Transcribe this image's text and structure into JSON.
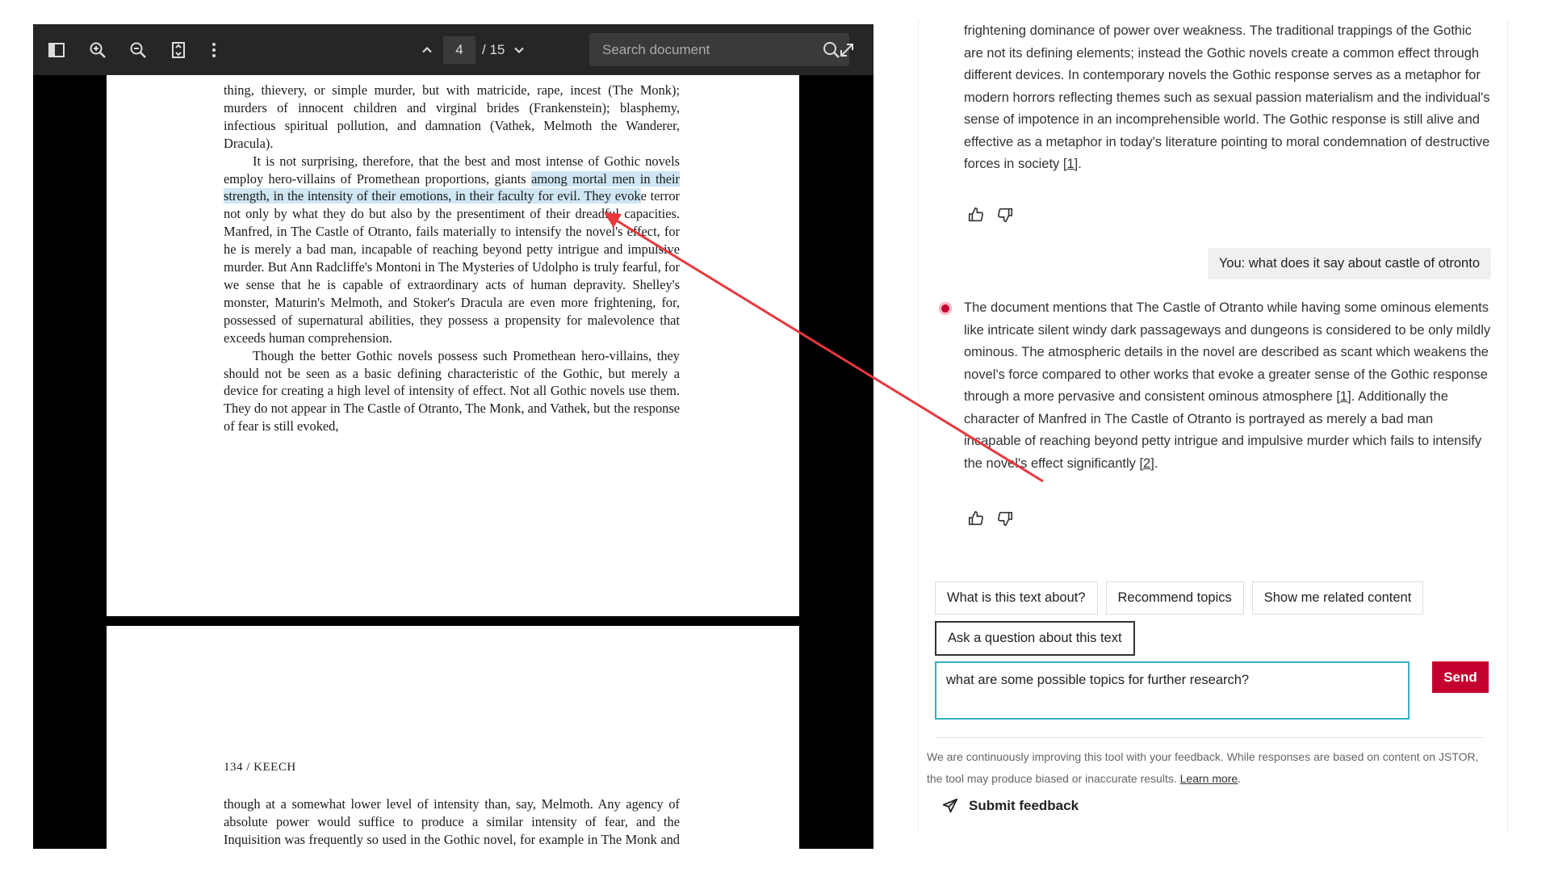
{
  "viewer": {
    "page_current": "4",
    "page_total": "/ 15",
    "search_placeholder": "Search document",
    "icons": [
      "sidebar-toggle-icon",
      "zoom-in-icon",
      "zoom-out-icon",
      "fit-page-icon",
      "more-options-icon",
      "page-up-icon",
      "page-down-icon",
      "search-icon",
      "fullscreen-icon"
    ]
  },
  "page1": {
    "para1": "thing, thievery, or simple murder, but with matricide, rape, incest (The Monk); murders of innocent children and virginal brides (Frankenstein); blasphemy, infectious spiritual pollution, and damnation (Vathek, Melmoth the Wanderer, Dracula).",
    "para2_a": "It is not surprising, therefore, that the best and most intense of Gothic novels employ hero-villains of Promethean proportions, giants ",
    "para2_hl": "among mortal men in their strength, in the intensity of their emotions, in their faculty for evil. They evok",
    "para2_b": "e terror not only by what they do but also by the presentiment of their dreadful capacities. Manfred, in The Castle of Otranto, fails materially to intensify the novel's effect, for he is merely a bad man, incapable of reaching beyond petty intrigue and impulsive murder. But Ann Radcliffe's Montoni in The Mysteries of Udolpho is truly fearful, for we sense that he is capable of extraordinary acts of human depravity. Shelley's monster, Maturin's Melmoth, and Stoker's Dracula are even more frightening, for, possessed of supernatural abilities, they possess a propensity for malevolence that exceeds human comprehension.",
    "para3": "Though the better Gothic novels possess such Promethean hero-villains, they should not be seen as a basic defining characteristic of the Gothic, but merely a device for creating a high level of intensity of effect. Not all Gothic novels use them. They do not appear in The Castle of Otranto, The Monk, and Vathek, but the response of fear is still evoked,"
  },
  "page2": {
    "running_head": "134   /   KEECH",
    "para1": "though at a somewhat lower level of intensity than, say, Melmoth. Any agency of absolute power would suffice to produce a similar intensity of fear, and the Inquisition was frequently so used in the Gothic novel, for example in The Monk and Melmoth the Wanderer."
  },
  "chat": {
    "msg1": "frightening dominance of power over weakness. The traditional trappings of the Gothic are not its defining elements; instead the Gothic novels create a common effect through different devices. In contemporary novels the Gothic response serves as a metaphor for modern horrors reflecting themes such as sexual passion materialism and the individual's sense of impotence in an incomprehensible world. The Gothic response is still alive and effective as a metaphor in today's literature pointing to moral condemnation of destructive forces in society ",
    "msg1_cite": "[1]",
    "user_msg": "You: what does it say about castle of otronto",
    "msg2_a": "The document mentions that The Castle of Otranto while having some ominous elements like intricate silent windy dark passageways and dungeons is considered to be only mildly ominous. The atmospheric details in the novel are described as scant which weakens the novel's force compared to other works that evoke a greater sense of the Gothic response through a more pervasive and consistent ominous atmosphere ",
    "msg2_cite1": "[1]",
    "msg2_b": ". Additionally the character of Manfred in The Castle of Otranto is portrayed as merely a bad man incapable of reaching beyond petty intrigue and impulsive murder which fails to intensify the novel's effect significantly ",
    "msg2_cite2": "[2]",
    "chips": [
      "What is this text about?",
      "Recommend topics",
      "Show me related content"
    ],
    "ask_label": "Ask a question about this text",
    "query_value": "what are some possible topics for further research?",
    "send_label": "Send",
    "disclaimer": "We are continuously improving this tool with your feedback. While responses are based on content on JSTOR, the tool may produce biased or inaccurate results. ",
    "learn_more": "Learn more",
    "submit_feedback": "Submit feedback",
    "accent_color": "#c3002f",
    "input_border_color": "#2fb3c4"
  }
}
